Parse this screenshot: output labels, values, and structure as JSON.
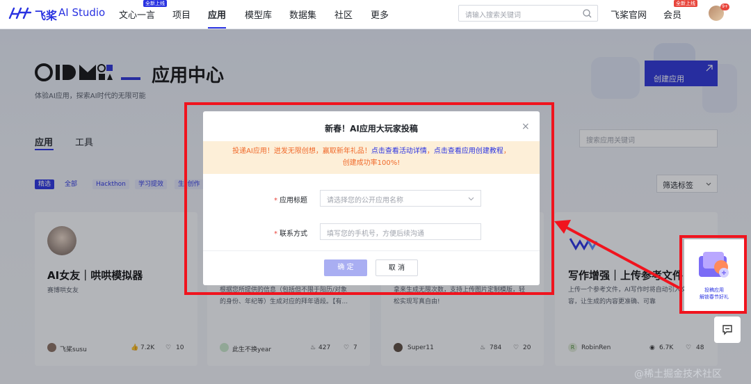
{
  "nav": {
    "brand_cn": "飞桨",
    "brand_en": "AI Studio",
    "items": [
      "文心一言",
      "项目",
      "应用",
      "模型库",
      "数据集",
      "社区",
      "更多"
    ],
    "new_badge": "全新上线",
    "search_placeholder": "请输入搜索关键词",
    "official_site": "飞桨官网",
    "member": "会员",
    "member_badge": "全新上线",
    "notif_count": "9+"
  },
  "hero": {
    "title": "应用中心",
    "subtitle": "体验AI应用，探索AI时代的无限可能",
    "create_button": "创建应用"
  },
  "tabs": [
    "应用",
    "工具"
  ],
  "app_search_placeholder": "搜索应用关键词",
  "filters": [
    "精选",
    "全部",
    "Hackthon",
    "学习提效",
    "生*创作"
  ],
  "filter_select": "筛选标签",
  "cards": [
    {
      "title": "AI女友｜哄哄模拟器",
      "desc": "赛博哄女友",
      "author": "飞桨susu",
      "likes": "7.2K",
      "hearts": "10"
    },
    {
      "title": "",
      "desc1": "根据您所提供的信息（包括但不限于阳历/对象",
      "desc2": "的身份、年纪等）生成对应的拜年语段。【有...",
      "author": "此生不换year",
      "likes": "427",
      "hearts": "7"
    },
    {
      "title": "",
      "desc1": "拿来生成无限次数，支持上传图片定制模版，轻",
      "desc2": "松实现写真自由!",
      "author": "Super11",
      "likes": "784",
      "hearts": "20"
    },
    {
      "title": "写作增强｜上传参考文件",
      "desc1": "上传一个参考文件，AI写作时将自动引入文件内",
      "desc2": "容，让生成的内容更准确、可靠",
      "author": "RobinRen",
      "likes": "6.7K",
      "hearts": "48"
    }
  ],
  "modal": {
    "title": "新春！AI应用大玩家投稿",
    "banner_pre": "投递AI应用！迸发无限创想，赢取新年礼品！",
    "banner_link1": "点击查看活动详情",
    "banner_mid": "，",
    "banner_link2": "点击查看应用创建教程",
    "banner_post": "，",
    "banner_line2": "创建成功率100%!",
    "field1_label": "应用标题",
    "field1_placeholder": "请选择您的公开应用名称",
    "field2_label": "联系方式",
    "field2_placeholder": "填写您的手机号，方便后续沟通",
    "required_mark": "*",
    "confirm": "确 定",
    "cancel": "取 消",
    "close": "×"
  },
  "widget": {
    "line1": "投稿应用",
    "line2": "解锁春节好礼"
  },
  "watermark": "@稀土掘金技术社区",
  "colors": {
    "accent": "#2932e1",
    "annotation": "#f0141e",
    "banner_bg": "#fdefd8",
    "banner_text": "#f06a2b"
  }
}
